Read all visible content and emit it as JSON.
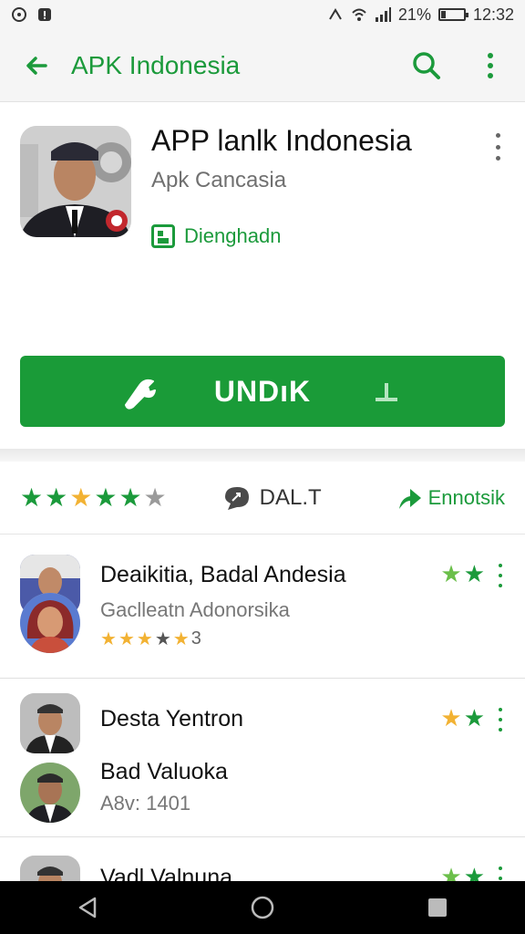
{
  "status_bar": {
    "battery_percent": "21%",
    "time": "12:32"
  },
  "app_bar": {
    "title": "APK Indonesia"
  },
  "app": {
    "title": "APP lanlk Indonesia",
    "subtitle": "Apk Cancasia",
    "developer": "Dienghadn",
    "install_label": "UNDıK"
  },
  "stats": {
    "rating_stars": 5,
    "middle_label": "DAL.T",
    "right_label": "Ennotsik"
  },
  "list": [
    {
      "title": "Deaikitia, Badal Andesia",
      "subtitle": "Gaclleatn Adonorsika",
      "rating_label": "3",
      "stars_shown": 2
    },
    {
      "title": "Desta Yentron",
      "stars_shown": 2
    },
    {
      "title": "Bad Valuoka",
      "subtitle": "A8v: 1401"
    },
    {
      "title": "Vadl Valnuna",
      "stars_shown": 2
    }
  ],
  "colors": {
    "accent": "#1b9a3b",
    "install_button": "#1a9b38",
    "star_gold": "#f2b233"
  },
  "icons": [
    "back-arrow-icon",
    "search-icon",
    "more-vert-icon",
    "developer-icon",
    "install-wrench-icon",
    "download-icon",
    "comment-icon",
    "share-icon",
    "nav-back-icon",
    "nav-home-icon",
    "nav-recents-icon"
  ]
}
